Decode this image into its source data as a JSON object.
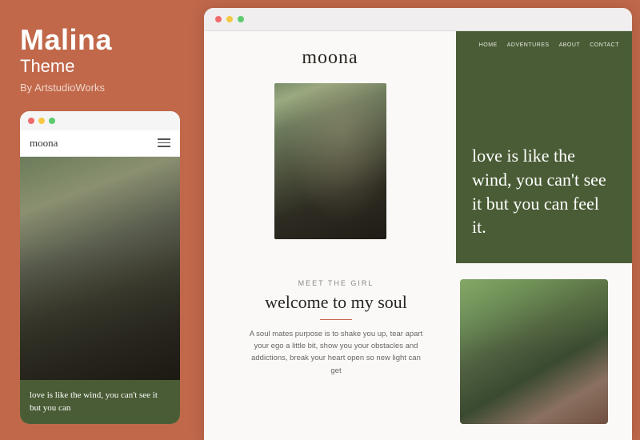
{
  "sidebar": {
    "title": "Malina",
    "subtitle": "Theme",
    "author": "By ArtstudioWorks",
    "dots": [
      "red",
      "yellow",
      "green"
    ],
    "mobile_logo": "moona",
    "mobile_text": "love is like the wind, you can't see it but you can"
  },
  "browser": {
    "dots": [
      "red",
      "yellow",
      "green"
    ],
    "site_logo": "moona",
    "nav_items": [
      "HOME",
      "ADVENTURES",
      "ABOUT",
      "CONTACT"
    ],
    "hero_quote": "love is like the wind, you can't see it but you can feel it.",
    "meet_label": "MEET THE GIRL",
    "welcome_title": "welcome to my soul",
    "welcome_body": "A soul mates purpose is to shake you up, tear apart your ego a little bit, show you your obstacles and addictions, break your heart open so new light can get"
  }
}
